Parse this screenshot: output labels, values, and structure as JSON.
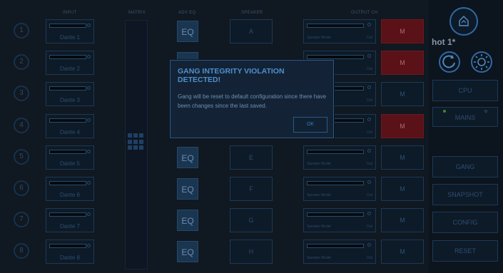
{
  "headers": {
    "input": "INPUT",
    "matrix": "MATRIX",
    "adv_eq": "ADV EQ",
    "speaker": "SPEAKER",
    "output_ch": "OUTPUT CH"
  },
  "rows": [
    {
      "num": "1",
      "input": "Dante 1",
      "eq": "EQ",
      "speaker": "A",
      "model": "Speaker Model",
      "out": "Out",
      "mute": "M",
      "muted": true
    },
    {
      "num": "2",
      "input": "Dante 2",
      "eq": "EQ",
      "speaker": "",
      "model": "Speaker Model",
      "out": "Out",
      "mute": "M",
      "muted": true
    },
    {
      "num": "3",
      "input": "Dante 3",
      "eq": "",
      "speaker": "",
      "model": "Speaker Model",
      "out": "Out",
      "mute": "M",
      "muted": false
    },
    {
      "num": "4",
      "input": "Dante 4",
      "eq": "",
      "speaker": "",
      "model": "Speaker Model",
      "out": "Out",
      "mute": "M",
      "muted": true
    },
    {
      "num": "5",
      "input": "Dante 5",
      "eq": "EQ",
      "speaker": "E",
      "model": "Speaker Model",
      "out": "Out",
      "mute": "M",
      "muted": false
    },
    {
      "num": "6",
      "input": "Dante 6",
      "eq": "EQ",
      "speaker": "F",
      "model": "Speaker Model",
      "out": "Out",
      "mute": "M",
      "muted": false
    },
    {
      "num": "7",
      "input": "Dante 7",
      "eq": "EQ",
      "speaker": "G",
      "model": "Speaker Model",
      "out": "Out",
      "mute": "M",
      "muted": false
    },
    {
      "num": "8",
      "input": "Dante 8",
      "eq": "EQ",
      "speaker": "H",
      "model": "Speaker Model",
      "out": "Out",
      "mute": "M",
      "muted": false
    }
  ],
  "sidebar": {
    "snapshot_name": "hot 1*",
    "cpu": "CPU",
    "mains": "MAINS",
    "gang": "GANG",
    "snapshot": "SNAPSHOT",
    "config": "CONFIG",
    "reset": "RESET"
  },
  "dialog": {
    "title": "GANG INTEGRITY VIOLATION DETECTED!",
    "body": "Gang will be reset to default configuration since there have been changes since the last saved.",
    "ok": "OK"
  },
  "colors": {
    "mute_active": "#5a1118",
    "accent": "#2e6aa6",
    "mains_led": "#3b8a2a"
  }
}
